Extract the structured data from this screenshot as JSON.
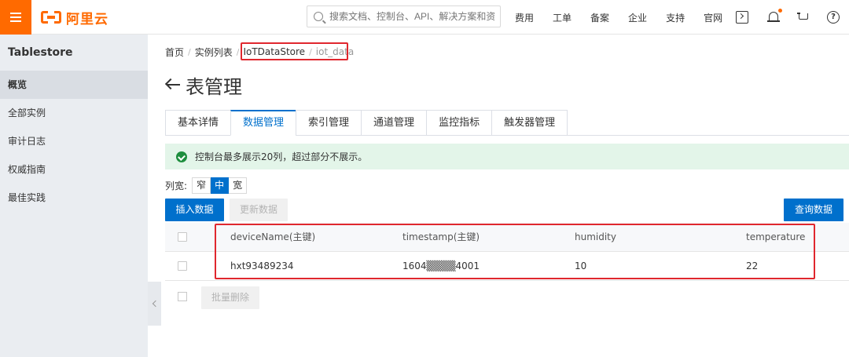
{
  "brand": {
    "name": "阿里云",
    "accent": "#ff6a00"
  },
  "search": {
    "placeholder": "搜索文档、控制台、API、解决方案和资源"
  },
  "nav": [
    "费用",
    "工单",
    "备案",
    "企业",
    "支持",
    "官网"
  ],
  "toolbar_icons": [
    "terminal-icon",
    "bell-icon",
    "cart-icon",
    "help-icon"
  ],
  "sidebar": {
    "title": "Tablestore",
    "items": [
      {
        "label": "概览",
        "active": true
      },
      {
        "label": "全部实例",
        "active": false
      },
      {
        "label": "审计日志",
        "active": false
      },
      {
        "label": "权威指南",
        "active": false
      },
      {
        "label": "最佳实践",
        "active": false
      }
    ]
  },
  "breadcrumb": [
    "首页",
    "实例列表",
    "IoTDataStore",
    "iot_data"
  ],
  "page": {
    "title": "表管理"
  },
  "tabs": [
    {
      "label": "基本详情",
      "active": false
    },
    {
      "label": "数据管理",
      "active": true
    },
    {
      "label": "索引管理",
      "active": false
    },
    {
      "label": "通道管理",
      "active": false
    },
    {
      "label": "监控指标",
      "active": false
    },
    {
      "label": "触发器管理",
      "active": false
    }
  ],
  "notice": {
    "text": "控制台最多展示20列，超过部分不展示。",
    "color": "#e3f5e9"
  },
  "column_width": {
    "label": "列宽:",
    "options": [
      "窄",
      "中",
      "宽"
    ],
    "selected": "中"
  },
  "actions": {
    "insert": "插入数据",
    "update": "更新数据",
    "query": "查询数据",
    "batch_delete": "批量删除"
  },
  "table": {
    "columns": [
      "deviceName(主键)",
      "timestamp(主键)",
      "humidity",
      "temperature"
    ],
    "rows": [
      [
        "hxt93489234",
        "1604▒▒▒▒4001",
        "10",
        "22"
      ]
    ]
  },
  "colors": {
    "primary": "#0070cc",
    "highlight": "#e0272e"
  }
}
